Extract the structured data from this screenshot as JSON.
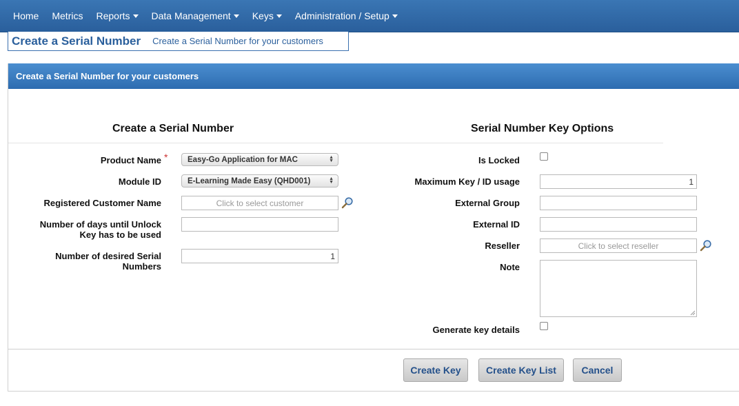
{
  "nav": {
    "items": [
      {
        "label": "Home",
        "dropdown": false
      },
      {
        "label": "Metrics",
        "dropdown": false
      },
      {
        "label": "Reports",
        "dropdown": true
      },
      {
        "label": "Data Management",
        "dropdown": true
      },
      {
        "label": "Keys",
        "dropdown": true
      },
      {
        "label": "Administration / Setup",
        "dropdown": true
      }
    ]
  },
  "page": {
    "title": "Create a Serial Number",
    "subtitle": "Create a Serial Number for your customers"
  },
  "panel": {
    "header": "Create a Serial Number for your customers"
  },
  "left": {
    "section_title": "Create a Serial Number",
    "product_name_label": "Product Name",
    "product_name_required": "*",
    "product_name_value": "Easy-Go Application for MAC",
    "module_id_label": "Module ID",
    "module_id_value": "E-Learning Made Easy (QHD001)",
    "customer_label": "Registered Customer Name",
    "customer_placeholder": "Click to select customer",
    "days_label_line1": "Number of days until Unlock",
    "days_label_line2": "Key has to be used",
    "days_value": "",
    "count_label_line1": "Number of desired Serial",
    "count_label_line2": "Numbers",
    "count_value": "1"
  },
  "right": {
    "section_title": "Serial Number Key Options",
    "is_locked_label": "Is Locked",
    "is_locked_checked": false,
    "max_usage_label": "Maximum Key / ID usage",
    "max_usage_value": "1",
    "external_group_label": "External Group",
    "external_group_value": "",
    "external_id_label": "External ID",
    "external_id_value": "",
    "reseller_label": "Reseller",
    "reseller_placeholder": "Click to select reseller",
    "note_label": "Note",
    "note_value": "",
    "generate_label": "Generate key details",
    "generate_checked": false
  },
  "buttons": {
    "create_key": "Create Key",
    "create_key_list": "Create Key List",
    "cancel": "Cancel"
  },
  "colors": {
    "nav_bg": "#2f6aa8",
    "accent": "#2a5f9c",
    "required": "#cc3333"
  },
  "icons": {
    "search": "magnifier-icon",
    "dropdown": "caret-down-icon"
  }
}
